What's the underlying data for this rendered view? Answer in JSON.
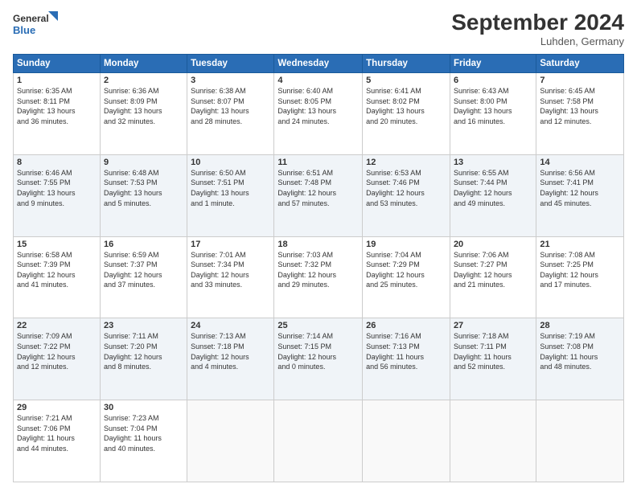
{
  "header": {
    "logo_line1": "General",
    "logo_line2": "Blue",
    "month_title": "September 2024",
    "location": "Luhden, Germany"
  },
  "days_of_week": [
    "Sunday",
    "Monday",
    "Tuesday",
    "Wednesday",
    "Thursday",
    "Friday",
    "Saturday"
  ],
  "weeks": [
    [
      {
        "day": "1",
        "info": "Sunrise: 6:35 AM\nSunset: 8:11 PM\nDaylight: 13 hours\nand 36 minutes."
      },
      {
        "day": "2",
        "info": "Sunrise: 6:36 AM\nSunset: 8:09 PM\nDaylight: 13 hours\nand 32 minutes."
      },
      {
        "day": "3",
        "info": "Sunrise: 6:38 AM\nSunset: 8:07 PM\nDaylight: 13 hours\nand 28 minutes."
      },
      {
        "day": "4",
        "info": "Sunrise: 6:40 AM\nSunset: 8:05 PM\nDaylight: 13 hours\nand 24 minutes."
      },
      {
        "day": "5",
        "info": "Sunrise: 6:41 AM\nSunset: 8:02 PM\nDaylight: 13 hours\nand 20 minutes."
      },
      {
        "day": "6",
        "info": "Sunrise: 6:43 AM\nSunset: 8:00 PM\nDaylight: 13 hours\nand 16 minutes."
      },
      {
        "day": "7",
        "info": "Sunrise: 6:45 AM\nSunset: 7:58 PM\nDaylight: 13 hours\nand 12 minutes."
      }
    ],
    [
      {
        "day": "8",
        "info": "Sunrise: 6:46 AM\nSunset: 7:55 PM\nDaylight: 13 hours\nand 9 minutes."
      },
      {
        "day": "9",
        "info": "Sunrise: 6:48 AM\nSunset: 7:53 PM\nDaylight: 13 hours\nand 5 minutes."
      },
      {
        "day": "10",
        "info": "Sunrise: 6:50 AM\nSunset: 7:51 PM\nDaylight: 13 hours\nand 1 minute."
      },
      {
        "day": "11",
        "info": "Sunrise: 6:51 AM\nSunset: 7:48 PM\nDaylight: 12 hours\nand 57 minutes."
      },
      {
        "day": "12",
        "info": "Sunrise: 6:53 AM\nSunset: 7:46 PM\nDaylight: 12 hours\nand 53 minutes."
      },
      {
        "day": "13",
        "info": "Sunrise: 6:55 AM\nSunset: 7:44 PM\nDaylight: 12 hours\nand 49 minutes."
      },
      {
        "day": "14",
        "info": "Sunrise: 6:56 AM\nSunset: 7:41 PM\nDaylight: 12 hours\nand 45 minutes."
      }
    ],
    [
      {
        "day": "15",
        "info": "Sunrise: 6:58 AM\nSunset: 7:39 PM\nDaylight: 12 hours\nand 41 minutes."
      },
      {
        "day": "16",
        "info": "Sunrise: 6:59 AM\nSunset: 7:37 PM\nDaylight: 12 hours\nand 37 minutes."
      },
      {
        "day": "17",
        "info": "Sunrise: 7:01 AM\nSunset: 7:34 PM\nDaylight: 12 hours\nand 33 minutes."
      },
      {
        "day": "18",
        "info": "Sunrise: 7:03 AM\nSunset: 7:32 PM\nDaylight: 12 hours\nand 29 minutes."
      },
      {
        "day": "19",
        "info": "Sunrise: 7:04 AM\nSunset: 7:29 PM\nDaylight: 12 hours\nand 25 minutes."
      },
      {
        "day": "20",
        "info": "Sunrise: 7:06 AM\nSunset: 7:27 PM\nDaylight: 12 hours\nand 21 minutes."
      },
      {
        "day": "21",
        "info": "Sunrise: 7:08 AM\nSunset: 7:25 PM\nDaylight: 12 hours\nand 17 minutes."
      }
    ],
    [
      {
        "day": "22",
        "info": "Sunrise: 7:09 AM\nSunset: 7:22 PM\nDaylight: 12 hours\nand 12 minutes."
      },
      {
        "day": "23",
        "info": "Sunrise: 7:11 AM\nSunset: 7:20 PM\nDaylight: 12 hours\nand 8 minutes."
      },
      {
        "day": "24",
        "info": "Sunrise: 7:13 AM\nSunset: 7:18 PM\nDaylight: 12 hours\nand 4 minutes."
      },
      {
        "day": "25",
        "info": "Sunrise: 7:14 AM\nSunset: 7:15 PM\nDaylight: 12 hours\nand 0 minutes."
      },
      {
        "day": "26",
        "info": "Sunrise: 7:16 AM\nSunset: 7:13 PM\nDaylight: 11 hours\nand 56 minutes."
      },
      {
        "day": "27",
        "info": "Sunrise: 7:18 AM\nSunset: 7:11 PM\nDaylight: 11 hours\nand 52 minutes."
      },
      {
        "day": "28",
        "info": "Sunrise: 7:19 AM\nSunset: 7:08 PM\nDaylight: 11 hours\nand 48 minutes."
      }
    ],
    [
      {
        "day": "29",
        "info": "Sunrise: 7:21 AM\nSunset: 7:06 PM\nDaylight: 11 hours\nand 44 minutes."
      },
      {
        "day": "30",
        "info": "Sunrise: 7:23 AM\nSunset: 7:04 PM\nDaylight: 11 hours\nand 40 minutes."
      },
      null,
      null,
      null,
      null,
      null
    ]
  ]
}
